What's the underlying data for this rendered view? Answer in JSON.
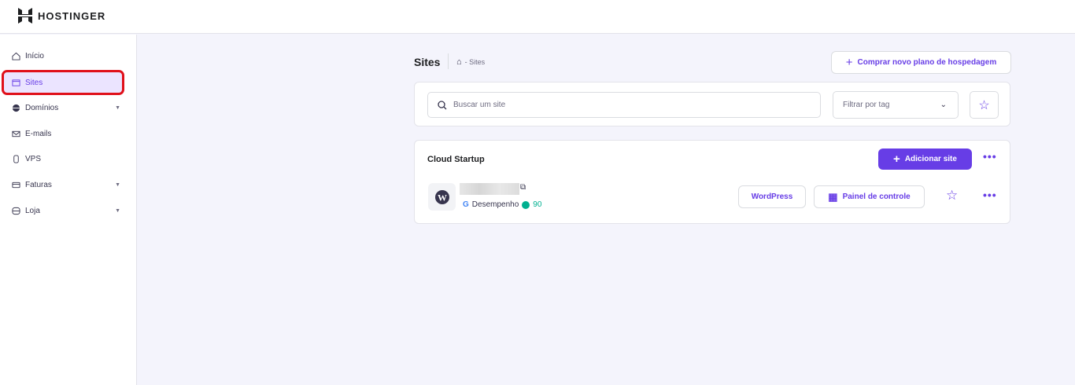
{
  "brand": "HOSTINGER",
  "sidebar": {
    "items": [
      {
        "label": "Início"
      },
      {
        "label": "Sites"
      },
      {
        "label": "Domínios"
      },
      {
        "label": "E-mails"
      },
      {
        "label": "VPS"
      },
      {
        "label": "Faturas"
      },
      {
        "label": "Loja"
      }
    ]
  },
  "header": {
    "title": "Sites",
    "breadcrumb": "- Sites",
    "buy_label": "Comprar novo plano de hospedagem"
  },
  "search": {
    "placeholder": "Buscar um site",
    "filter": "Filtrar por tag"
  },
  "plan": {
    "name": "Cloud Startup",
    "add_label": "Adicionar site",
    "site": {
      "perf_label": "Desempenho",
      "score": "90",
      "wp_label": "WordPress",
      "panel_label": "Painel de controle"
    }
  },
  "colors": {
    "accent": "#673de6",
    "score": "#00b090"
  }
}
